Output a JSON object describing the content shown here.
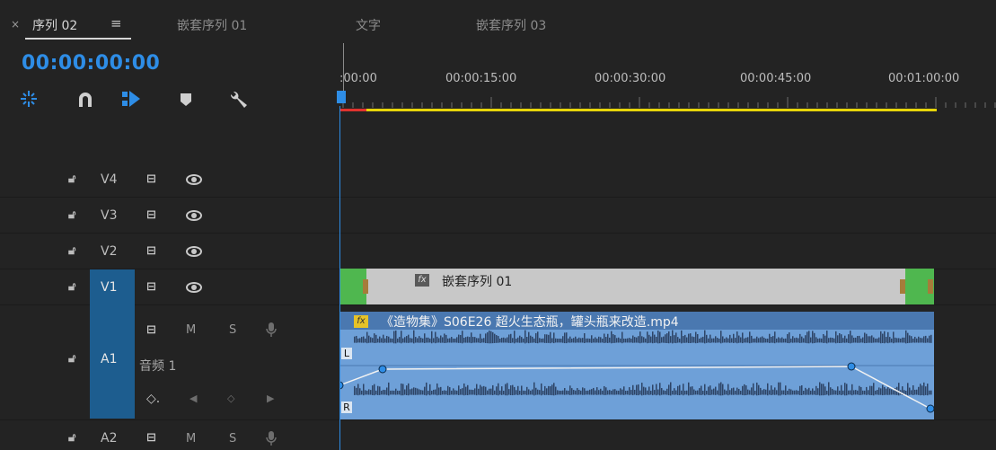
{
  "tabs": {
    "close": "×",
    "items": [
      {
        "label": "序列 02"
      },
      {
        "label": "嵌套序列 01"
      },
      {
        "label": "文字"
      },
      {
        "label": "嵌套序列 03"
      }
    ],
    "menu": "≡"
  },
  "timecode": "00:00:00:00",
  "ruler": {
    "labels": [
      ":00:00",
      "00:00:15:00",
      "00:00:30:00",
      "00:00:45:00",
      "00:01:00:00"
    ]
  },
  "tracks": {
    "v4": {
      "name": "V4"
    },
    "v3": {
      "name": "V3"
    },
    "v2": {
      "name": "V2"
    },
    "v1": {
      "name": "V1"
    },
    "a1": {
      "name": "A1",
      "title": "音频 1",
      "m": "M",
      "s": "S"
    },
    "a2": {
      "name": "A2",
      "m": "M",
      "s": "S"
    }
  },
  "clips": {
    "v1": {
      "fx": "fx",
      "label": "嵌套序列 01"
    },
    "a1": {
      "fx": "fx",
      "label": "《造物集》S06E26 超火生态瓶，罐头瓶来改造.mp4",
      "left": "L",
      "right": "R"
    }
  },
  "colors": {
    "accent": "#2e8de6",
    "clip_green": "#4fb74f",
    "audio_clip": "#6ea0d8",
    "work_area": "#e6d40a"
  }
}
